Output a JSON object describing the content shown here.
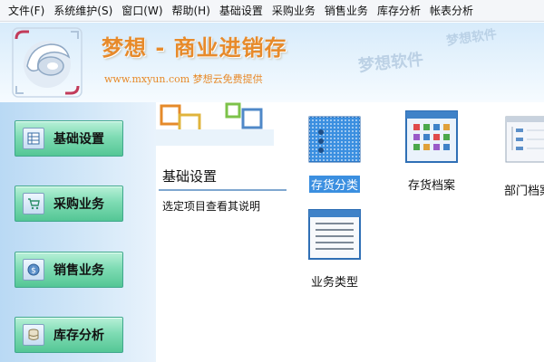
{
  "menu": [
    "文件(F)",
    "系统维护(S)",
    "窗口(W)",
    "帮助(H)",
    "基础设置",
    "采购业务",
    "销售业务",
    "库存分析",
    "帐表分析"
  ],
  "banner": {
    "title": "梦想 - 商业进销存",
    "subtitle": "www.mxyun.com 梦想云免费提供",
    "watermark": "梦想软件"
  },
  "nav": [
    {
      "label": "基础设置",
      "icon": "table-icon"
    },
    {
      "label": "采购业务",
      "icon": "cart-icon"
    },
    {
      "label": "销售业务",
      "icon": "coin-icon"
    },
    {
      "label": "库存分析",
      "icon": "database-icon"
    }
  ],
  "panel": {
    "title": "基础设置",
    "description": "选定项目查看其说明"
  },
  "functions": [
    {
      "label": "存货分类",
      "icon": "category-icon",
      "selected": true
    },
    {
      "label": "存货档案",
      "icon": "grid-archive-icon",
      "selected": false
    },
    {
      "label": "部门档案",
      "icon": "department-tree-icon",
      "selected": false
    },
    {
      "label": "业务类型",
      "icon": "list-document-icon",
      "selected": false
    }
  ],
  "colors": {
    "accent": "#e78a2a",
    "nav_button": "#7fdcb4",
    "selection": "#3b8fe0"
  }
}
